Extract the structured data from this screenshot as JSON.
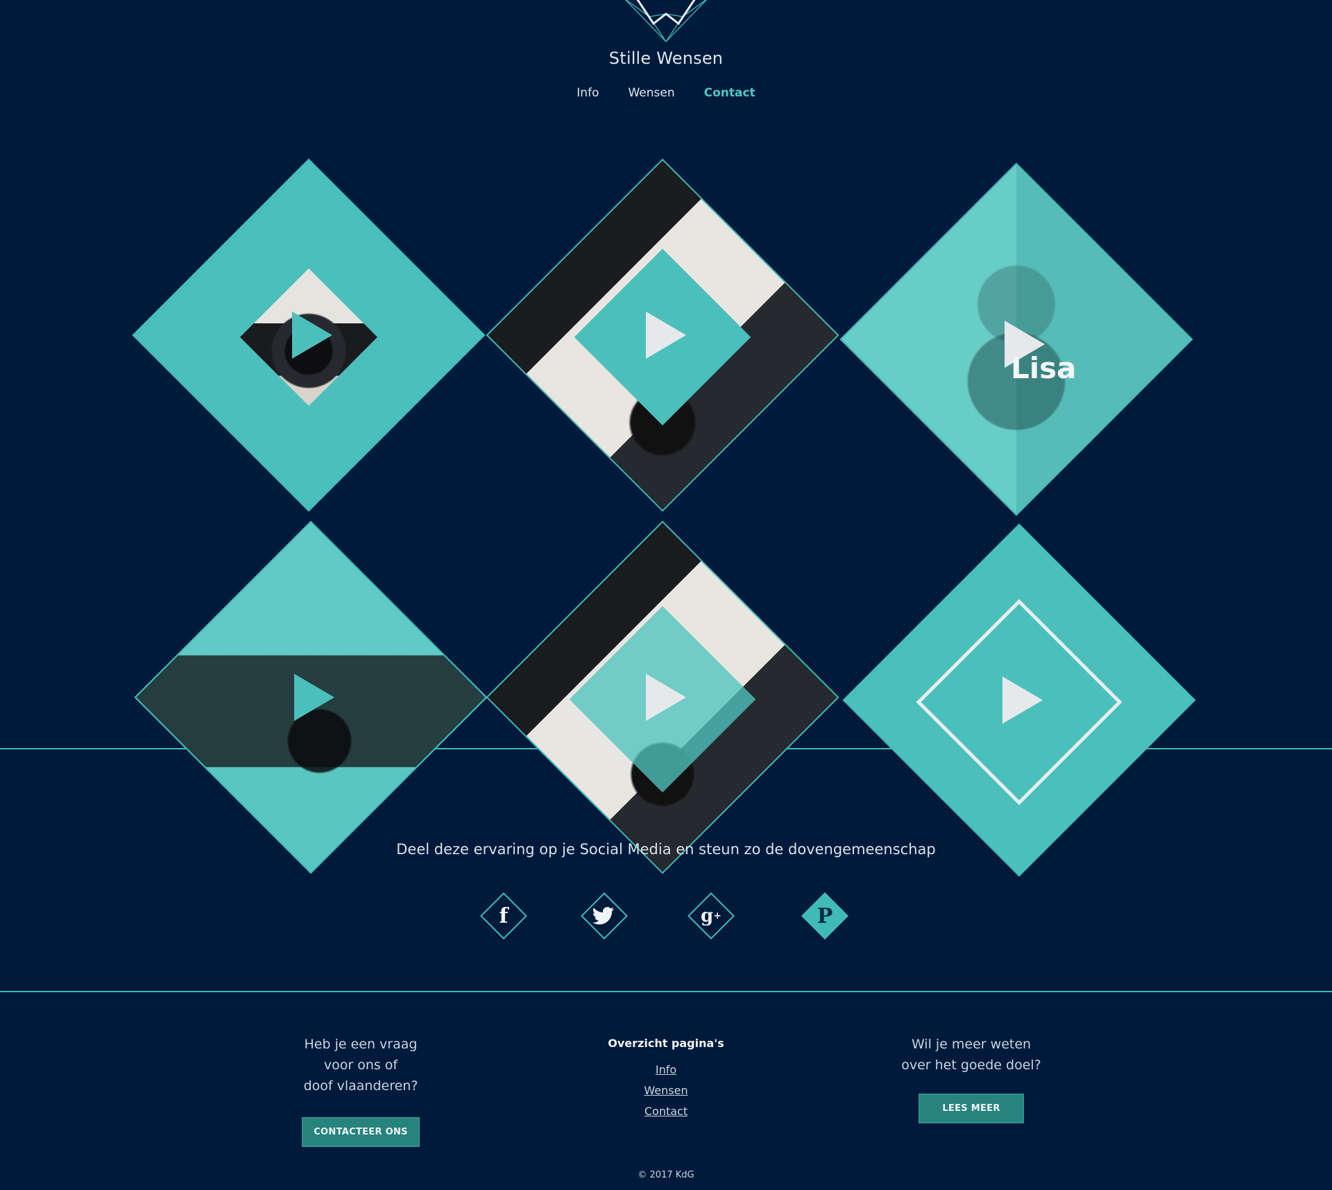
{
  "brand": {
    "name": "Stille Wensen"
  },
  "nav": {
    "items": [
      {
        "label": "Info"
      },
      {
        "label": "Wensen"
      },
      {
        "label": "Contact"
      }
    ]
  },
  "tiles": [
    {
      "name": ""
    },
    {
      "name": ""
    },
    {
      "name": "Lisa"
    },
    {
      "name": ""
    },
    {
      "name": ""
    },
    {
      "name": ""
    }
  ],
  "share": {
    "text": "Deel deze ervaring op je Social Media en steun zo de dovengemeenschap",
    "icons": [
      "facebook-icon",
      "twitter-icon",
      "google-plus-icon",
      "pinterest-icon"
    ]
  },
  "footer": {
    "left": {
      "line1": "Heb je een vraag",
      "line2": "voor ons of",
      "line3": "doof vlaanderen?",
      "button": "CONTACTEER ONS"
    },
    "middle": {
      "heading": "Overzicht pagina's",
      "links": [
        "Info",
        "Wensen",
        "Contact"
      ]
    },
    "right": {
      "line1": "Wil je meer weten",
      "line2": "over het goede doel?",
      "button": "LEES MEER"
    },
    "copyright": "© 2017 KdG"
  },
  "colors": {
    "background": "#001a3c",
    "accent": "#3fbab6",
    "button": "#26837e"
  }
}
